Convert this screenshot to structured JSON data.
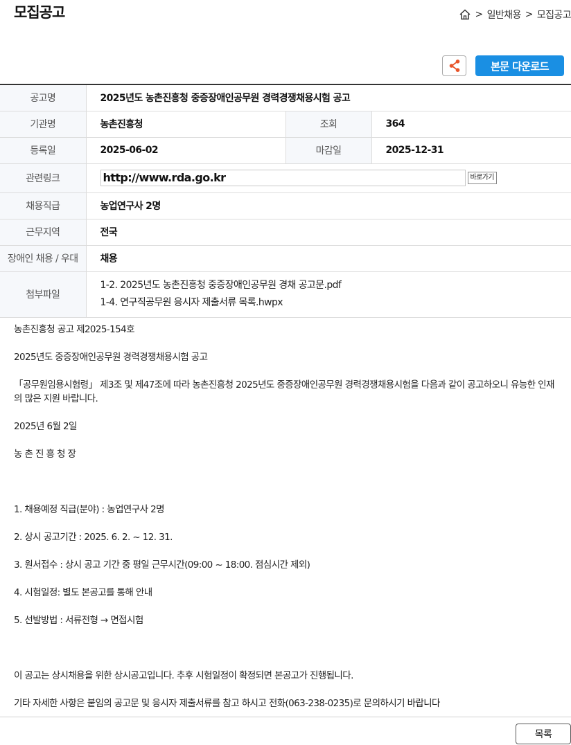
{
  "page": {
    "title": "모집공고"
  },
  "breadcrumb": {
    "home_icon": "home-icon",
    "separator": ">",
    "items": [
      "일반채용",
      "모집공고"
    ]
  },
  "actions": {
    "share_icon": "share-icon",
    "download_label": "본문 다운로드",
    "accent_color": "#1a8fe3"
  },
  "info": {
    "title_label": "공고명",
    "title_value": "2025년도 농촌진흥청 중증장애인공무원 경력경쟁채용시험 공고",
    "org_label": "기관명",
    "org_value": "농촌진흥청",
    "views_label": "조회",
    "views_value": "364",
    "reg_label": "등록일",
    "reg_value": "2025-06-02",
    "deadline_label": "마감일",
    "deadline_value": "2025-12-31",
    "link_label": "관련링크",
    "link_value": "http://www.rda.go.kr",
    "link_button": "바로가기",
    "position_label": "채용직급",
    "position_value": "농업연구사 2명",
    "region_label": "근무지역",
    "region_value": "전국",
    "disabled_label": "장애인 채용 / 우대",
    "disabled_value": "채용",
    "files_label": "첨부파일",
    "files": [
      "1-2. 2025년도 농촌진흥청 중증장애인공무원 경채 공고문.pdf",
      "1-4. 연구직공무원 응시자 제출서류 목록.hwpx"
    ]
  },
  "body": {
    "lines": [
      "농촌진흥청 공고 제2025-154호",
      "2025년도 중증장애인공무원 경력경쟁채용시험 공고",
      "「공무원임용시험령」 제3조 및 제47조에 따라 농촌진흥청 2025년도 중증장애인공무원 경력경쟁채용시험을 다음과 같이 공고하오니 유능한 인재의 많은 지원 바랍니다.",
      "2025년 6월 2일",
      "농 촌 진 흥 청 장",
      "1. 채용예정 직급(분야) : 농업연구사 2명",
      "2. 상시 공고기간 : 2025. 6. 2. ~ 12. 31.",
      "3. 원서접수 : 상시 공고 기간 중 평일 근무시간(09:00 ~ 18:00. 점심시간 제외)",
      "4. 시험일정: 별도 본공고를 통해 안내",
      "5. 선발방법 : 서류전형 → 면접시험",
      "이 공고는 상시채용을 위한 상시공고입니다. 추후 시험일정이 확정되면 본공고가 진행됩니다.",
      "기타 자세한 사항은 붙임의 공고문 및 응시자 제출서류를 참고 하시고 전화(063-238-0235)로 문의하시기 바랍니다"
    ]
  },
  "footer": {
    "list_button": "목록"
  }
}
